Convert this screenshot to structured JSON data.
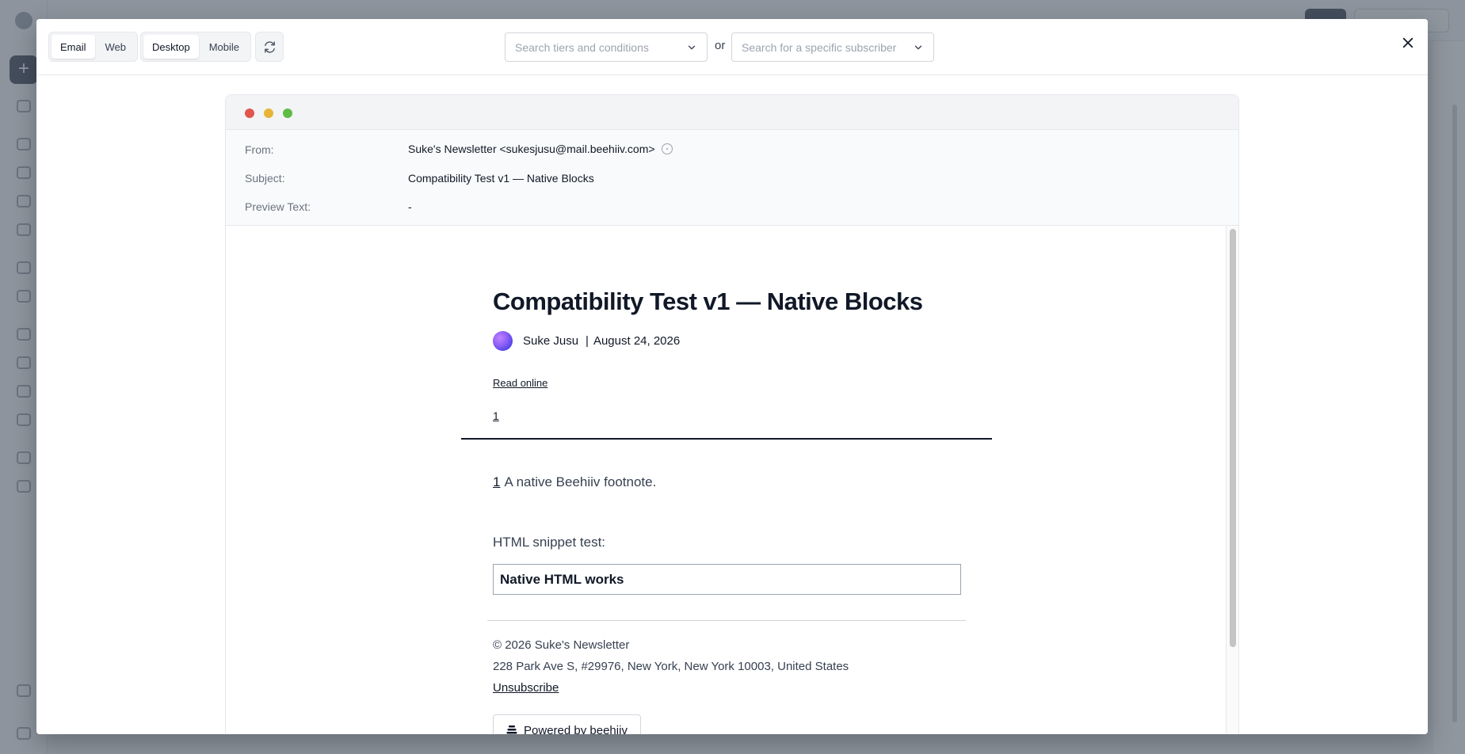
{
  "toolbar": {
    "view_mode": {
      "options": [
        "Email",
        "Web"
      ],
      "active": "Email"
    },
    "device_mode": {
      "options": [
        "Desktop",
        "Mobile"
      ],
      "active": "Desktop"
    },
    "refresh_icon": "refresh-icon",
    "tiers_search": {
      "placeholder": "Search tiers and conditions"
    },
    "or_label": "or",
    "subscriber_search": {
      "placeholder": "Search for a specific subscriber"
    },
    "close_icon": "close-icon"
  },
  "window": {
    "dots": {
      "red": "#e0574d",
      "yellow": "#e8b437",
      "green": "#5ebc45"
    }
  },
  "meta": {
    "from": {
      "label": "From:",
      "value": "Suke's Newsletter <sukesjusu@mail.beehiiv.com>"
    },
    "subject": {
      "label": "Subject:",
      "value": "Compatibility Test v1 — Native Blocks"
    },
    "preview_text": {
      "label": "Preview Text:",
      "value": "-"
    }
  },
  "email": {
    "title": "Compatibility Test v1 — Native Blocks",
    "author": "Suke Jusu",
    "separator": "|",
    "date": "August 24, 2026",
    "read_online": "Read online",
    "footnote_ref": "1",
    "footnote": {
      "number": "1",
      "text": "A native Beehiiv footnote."
    },
    "snippet_label": "HTML snippet test:",
    "snippet_content": "Native HTML works",
    "footer": {
      "copyright": "© 2026 Suke's Newsletter",
      "address": "228 Park Ave S, #29976, New York, New York 10003, United States",
      "unsubscribe": "Unsubscribe",
      "powered_by": "Powered by beehiiv"
    }
  }
}
